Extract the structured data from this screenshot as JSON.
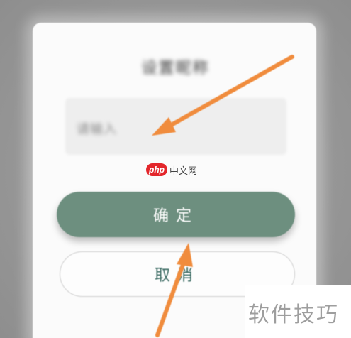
{
  "dialog": {
    "title": "设置昵称",
    "input_text": "请输入",
    "confirm_label": "确定",
    "cancel_label": "取消"
  },
  "watermarks": {
    "php_logo": "php",
    "php_site": "中文网",
    "corner_text": "软件技巧"
  },
  "colors": {
    "accent": "#6d8f7f",
    "arrow": "#f08c3c",
    "cancel_text": "#3b6b63"
  }
}
